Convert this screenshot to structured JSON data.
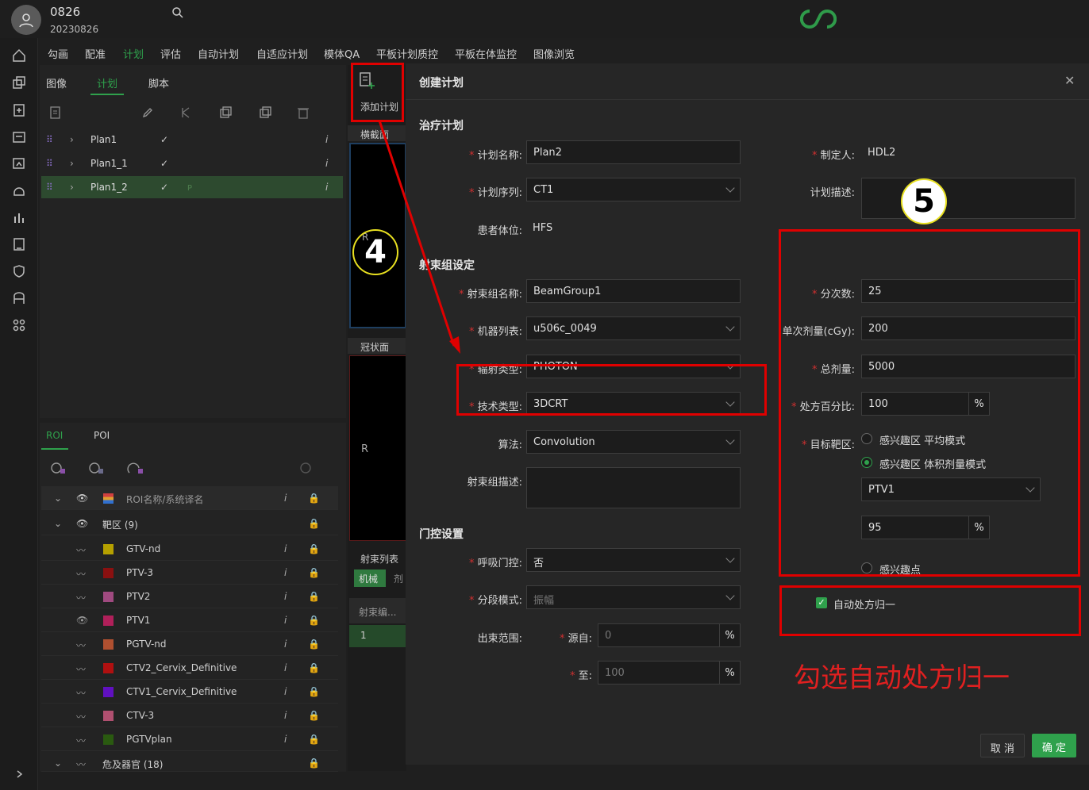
{
  "header": {
    "patient_id": "0826",
    "patient_date": "20230826"
  },
  "menu": [
    "勾画",
    "配准",
    "计划",
    "评估",
    "自动计划",
    "自适应计划",
    "模体QA",
    "平板计划质控",
    "平板在体监控",
    "图像浏览"
  ],
  "subtabs": [
    "图像",
    "计划",
    "脚本"
  ],
  "plans": [
    {
      "name": "Plan1"
    },
    {
      "name": "Plan1_1"
    },
    {
      "name": "Plan1_2"
    }
  ],
  "info_icon": "i",
  "roi_tabs": [
    "ROI",
    "POI"
  ],
  "roi_header": "ROI名称/系统译名",
  "roi_group": "靶区 (9)",
  "roi_items": [
    {
      "name": "GTV-nd",
      "color": "#b5a000"
    },
    {
      "name": "PTV-3",
      "color": "#8a1010"
    },
    {
      "name": "PTV2",
      "color": "#a04a80"
    },
    {
      "name": "PTV1",
      "color": "#b0205a"
    },
    {
      "name": "PGTV-nd",
      "color": "#b05030"
    },
    {
      "name": "CTV2_Cervix_Definitive",
      "color": "#b01010"
    },
    {
      "name": "CTV1_Cervix_Definitive",
      "color": "#6010c0"
    },
    {
      "name": "CTV-3",
      "color": "#b05070"
    },
    {
      "name": "PGTVplan",
      "color": "#2a5a10"
    }
  ],
  "roi_group2": "危及器官 (18)",
  "viewer": {
    "add_plan": "添加计划",
    "axial": "横截面",
    "coronal": "冠状面",
    "beam_list": "射束列表",
    "machine_tab": "机械",
    "dose_tab": "剂",
    "beam_num": "射束编...",
    "beam_row": "1",
    "r_label": "R"
  },
  "dialog": {
    "title": "创建计划",
    "sec_plan": "治疗计划",
    "plan_name_label": "计划名称:",
    "plan_name": "Plan2",
    "maker_label": "制定人:",
    "maker": "HDL2",
    "series_label": "计划序列:",
    "series": "CT1",
    "desc_label": "计划描述:",
    "position_label": "患者体位:",
    "position": "HFS",
    "sec_beam": "射束组设定",
    "bg_name_label": "射束组名称:",
    "bg_name": "BeamGroup1",
    "machine_label": "机器列表:",
    "machine": "u506c_0049",
    "rad_label": "辐射类型:",
    "rad": "PHOTON",
    "tech_label": "技术类型:",
    "tech": "3DCRT",
    "algo_label": "算法:",
    "algo": "Convolution",
    "bg_desc_label": "射束组描述:",
    "sec_gate": "门控设置",
    "breath_label": "呼吸门控:",
    "breath": "否",
    "seg_label": "分段模式:",
    "seg": "振幅",
    "range_label": "出束范围:",
    "from_label": "源自:",
    "from": "0",
    "to_label": "至:",
    "to": "100",
    "pct": "%",
    "fractions_label": "分次数:",
    "fractions": "25",
    "single_dose_label": "单次剂量(cGy):",
    "single_dose": "200",
    "total_dose_label": "总剂量:",
    "total_dose": "5000",
    "rx_pct_label": "处方百分比:",
    "rx_pct": "100",
    "target_label": "目标靶区:",
    "opt_avg": "感兴趣区 平均模式",
    "opt_vol": "感兴趣区 体积剂量模式",
    "target_roi": "PTV1",
    "vol_pct": "95",
    "opt_point": "感兴趣点",
    "auto_norm": "自动处方归一",
    "cancel": "取 消",
    "ok": "确 定"
  },
  "annotations": {
    "step4": "4",
    "step5": "5",
    "note": "勾选自动处方归一"
  }
}
